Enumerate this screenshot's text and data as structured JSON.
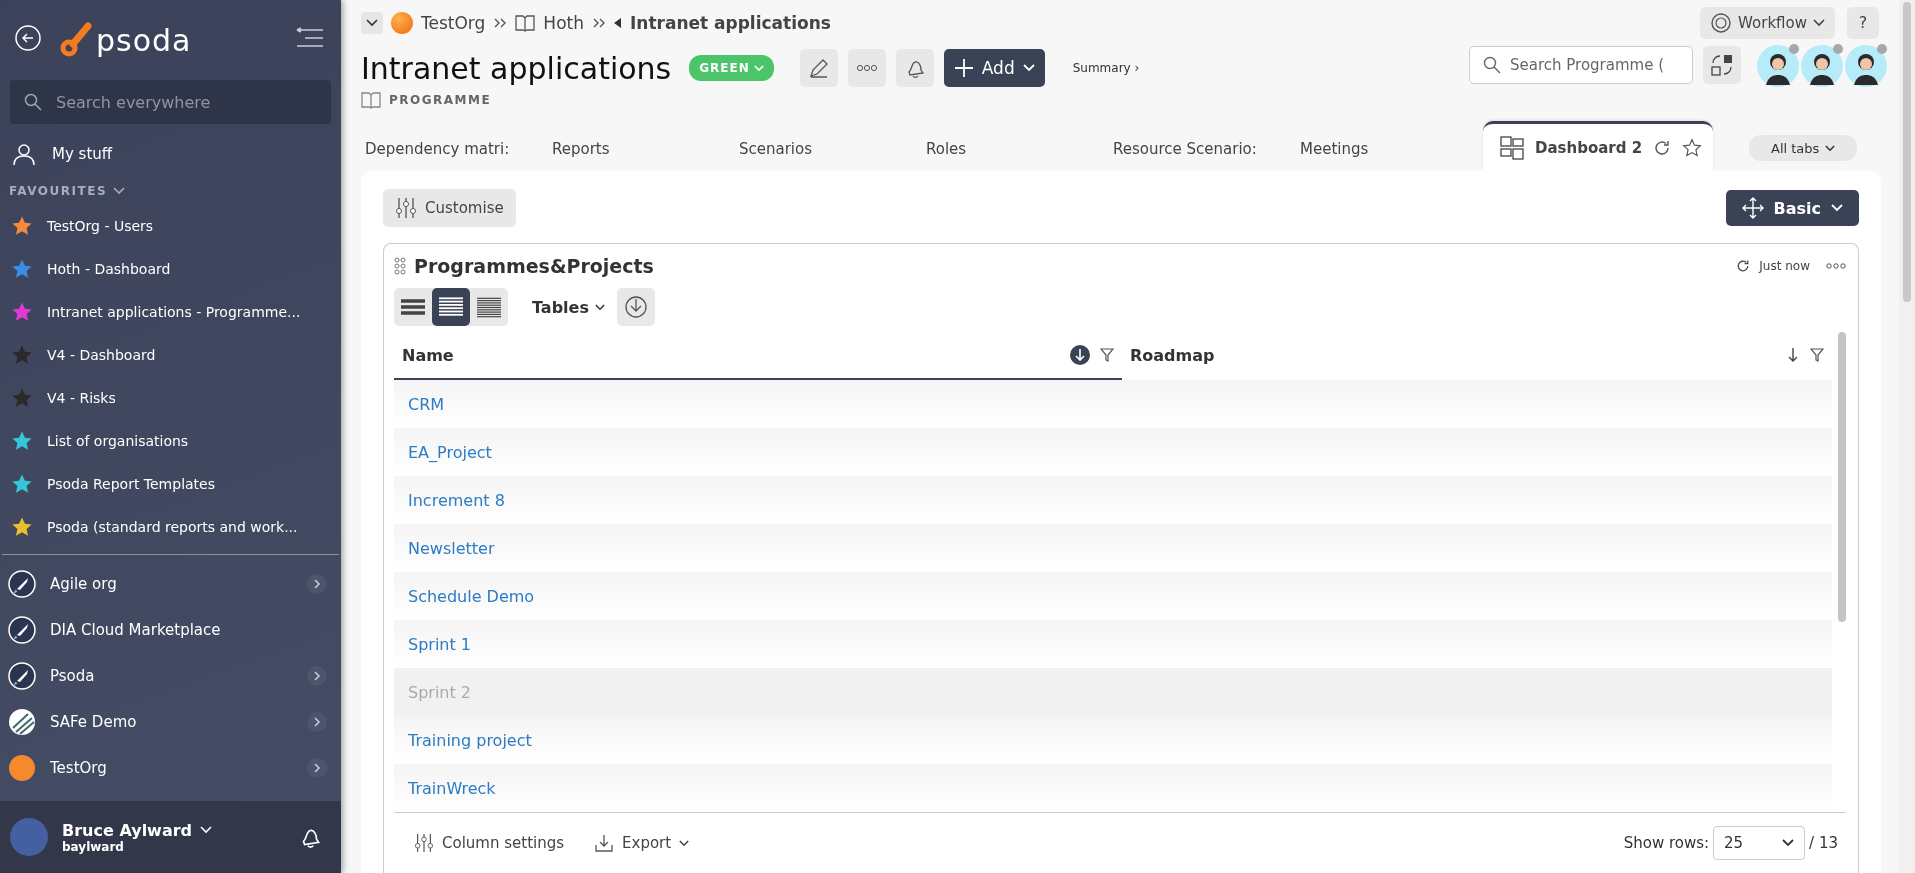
{
  "sidebar": {
    "logo": "psoda",
    "search": {
      "placeholder": "Search everywhere"
    },
    "my_stuff": "My stuff",
    "favourites_heading": "FAVOURITES",
    "favourites": [
      {
        "label": "TestOrg - Users",
        "color": "#f58a3c"
      },
      {
        "label": "Hoth - Dashboard",
        "color": "#3a8ee6"
      },
      {
        "label": "Intranet applications - Programme...",
        "color": "#e03ad6"
      },
      {
        "label": "V4 - Dashboard",
        "color": "#2a2a2a"
      },
      {
        "label": "V4 - Risks",
        "color": "#2a2a2a"
      },
      {
        "label": "List of organisations",
        "color": "#35c6d8"
      },
      {
        "label": "Psoda Report Templates",
        "color": "#35c6d8"
      },
      {
        "label": "Psoda (standard reports and work...",
        "color": "#e8c02e"
      }
    ],
    "organisations": [
      {
        "label": "Agile org",
        "kind": "rocket",
        "has_children": true
      },
      {
        "label": "DIA Cloud Marketplace",
        "kind": "rocket",
        "has_children": false
      },
      {
        "label": "Psoda",
        "kind": "rocket",
        "has_children": true
      },
      {
        "label": "SAFe Demo",
        "kind": "stripes",
        "has_children": true
      },
      {
        "label": "TestOrg",
        "kind": "sun",
        "has_children": true
      }
    ],
    "user": {
      "name": "Bruce Aylward",
      "username": "baylward"
    }
  },
  "breadcrumb": [
    {
      "label": "TestOrg",
      "kind": "org"
    },
    {
      "label": "Hoth",
      "kind": "programme"
    },
    {
      "label": "Intranet applications",
      "kind": "current"
    }
  ],
  "header": {
    "title": "Intranet applications",
    "status": "GREEN",
    "type": "PROGRAMME",
    "add_button": "Add",
    "summary_link": "Summary ›",
    "workflow_button": "Workflow",
    "help_button": "?",
    "search": {
      "placeholder": "Search Programme ("
    }
  },
  "tabs": [
    {
      "label": "Dependency matri:",
      "selected": false
    },
    {
      "label": "Reports",
      "selected": false
    },
    {
      "label": "Scenarios",
      "selected": false
    },
    {
      "label": "Roles",
      "selected": false
    },
    {
      "label": "Resource Scenario:",
      "selected": false
    },
    {
      "label": "Meetings",
      "selected": false
    },
    {
      "label": "Dashboard 2",
      "selected": true
    }
  ],
  "all_tabs": "All tabs",
  "dashboard": {
    "customise_button": "Customise",
    "layout_button": "Basic",
    "widget": {
      "title": "Programmes&Projects",
      "refreshed": "Just now",
      "density": [
        {
          "selected": false
        },
        {
          "selected": true
        },
        {
          "selected": false
        }
      ],
      "view_menu": "Tables",
      "columns": [
        {
          "label": "Name",
          "sorted": true
        },
        {
          "label": "Roadmap",
          "sorted": false
        }
      ],
      "rows": [
        {
          "name": "CRM",
          "disabled": false
        },
        {
          "name": "EA_Project",
          "disabled": false
        },
        {
          "name": "Increment 8",
          "disabled": false
        },
        {
          "name": "Newsletter",
          "disabled": false
        },
        {
          "name": "Schedule Demo",
          "disabled": false
        },
        {
          "name": "Sprint 1",
          "disabled": false
        },
        {
          "name": "Sprint 2",
          "disabled": true
        },
        {
          "name": "Training project",
          "disabled": false
        },
        {
          "name": "TrainWreck",
          "disabled": false
        }
      ],
      "column_settings": "Column settings",
      "export": "Export",
      "show_rows_label": "Show rows:",
      "page_size": "25",
      "total": "/ 13"
    }
  }
}
